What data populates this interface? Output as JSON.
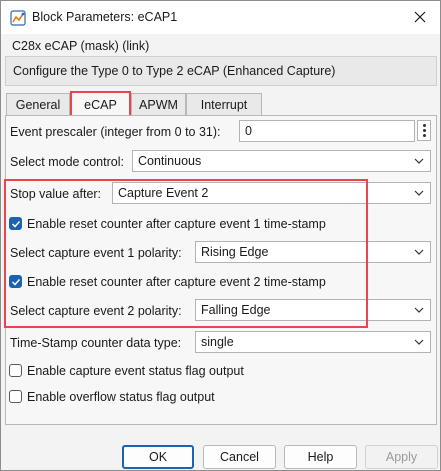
{
  "window": {
    "title": "Block Parameters: eCAP1"
  },
  "mask": {
    "title": "C28x eCAP (mask) (link)",
    "description": "Configure the Type 0 to Type 2 eCAP (Enhanced Capture)"
  },
  "tabs": [
    {
      "label": "General",
      "active": false
    },
    {
      "label": "eCAP",
      "active": true
    },
    {
      "label": "APWM",
      "active": false
    },
    {
      "label": "Interrupt",
      "active": false
    }
  ],
  "params": {
    "event_prescaler": {
      "label": "Event prescaler (integer from 0 to 31):",
      "value": "0"
    },
    "mode_control": {
      "label": "Select mode control:",
      "value": "Continuous"
    },
    "stop_value": {
      "label": "Stop value after:",
      "value": "Capture Event 2"
    },
    "reset_counter_1": {
      "label": "Enable reset counter after capture event 1 time-stamp",
      "checked": true
    },
    "polarity_1": {
      "label": "Select capture event 1 polarity:",
      "value": "Rising Edge"
    },
    "reset_counter_2": {
      "label": "Enable reset counter after capture event 2 time-stamp",
      "checked": true
    },
    "polarity_2": {
      "label": "Select capture event 2 polarity:",
      "value": "Falling Edge"
    },
    "timestamp_type": {
      "label": "Time-Stamp counter data type:",
      "value": "single"
    },
    "status_flag": {
      "label": "Enable capture event status flag output",
      "checked": false
    },
    "overflow_flag": {
      "label": "Enable overflow status flag output",
      "checked": false
    }
  },
  "buttons": {
    "ok": "OK",
    "cancel": "Cancel",
    "help": "Help",
    "apply": "Apply"
  },
  "colors": {
    "highlight": "#e8454d",
    "accent": "#1b62b0"
  }
}
